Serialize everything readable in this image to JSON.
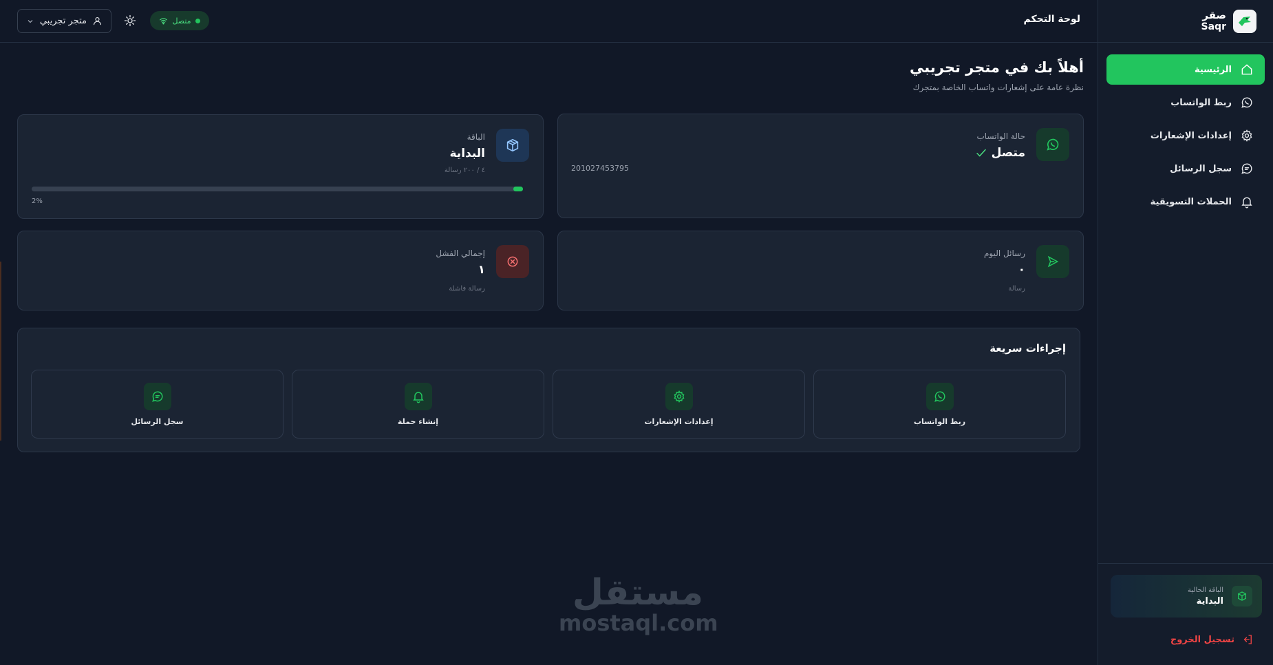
{
  "brand": {
    "name_ar": "صقر",
    "name_en": "Saqr"
  },
  "sidebar": {
    "items": [
      {
        "label": "الرئيسية",
        "icon": "home-icon",
        "active": true
      },
      {
        "label": "ربط الواتساب",
        "icon": "whatsapp-icon",
        "active": false
      },
      {
        "label": "إعدادات الإشعارات",
        "icon": "gear-icon",
        "active": false
      },
      {
        "label": "سجل الرسائل",
        "icon": "message-icon",
        "active": false
      },
      {
        "label": "الحملات التسويقية",
        "icon": "bell-icon",
        "active": false
      }
    ],
    "current_plan_label": "الباقة الحالية",
    "current_plan_name": "البداية",
    "logout_label": "تسجيل الخروج"
  },
  "topbar": {
    "title": "لوحة التحكم",
    "account_name": "متجر تجريبي",
    "status_label": "متصل"
  },
  "welcome": {
    "title": "أهلاً بك في متجر تجريبي",
    "subtitle": "نظرة عامة على إشعارات واتساب الخاصة بمتجرك"
  },
  "cards": {
    "whatsapp": {
      "label": "حالة الواتساب",
      "value": "متصل",
      "phone": "201027453795"
    },
    "plan": {
      "label": "الباقة",
      "value": "البداية",
      "usage": "٤ / ٢٠٠ رسالة",
      "progress_percent": 2,
      "progress_text": "2%"
    },
    "today": {
      "label": "رسائل اليوم",
      "value": "٠",
      "sub": "رسالة"
    },
    "failed": {
      "label": "إجمالي الفشل",
      "value": "١",
      "sub": "رسالة فاشلة"
    }
  },
  "quick_actions": {
    "title": "إجراءات سريعة",
    "items": [
      {
        "label": "ربط الواتساب",
        "icon": "whatsapp-icon"
      },
      {
        "label": "إعدادات الإشعارات",
        "icon": "gear-icon"
      },
      {
        "label": "إنشاء حملة",
        "icon": "bell-icon"
      },
      {
        "label": "سجل الرسائل",
        "icon": "message-icon"
      }
    ]
  },
  "watermark": {
    "ar": "مستقل",
    "en": "mostaql.com"
  },
  "colors": {
    "accent": "#22c55e",
    "danger": "#ef4444",
    "background": "#111827",
    "card": "#1b2433"
  }
}
